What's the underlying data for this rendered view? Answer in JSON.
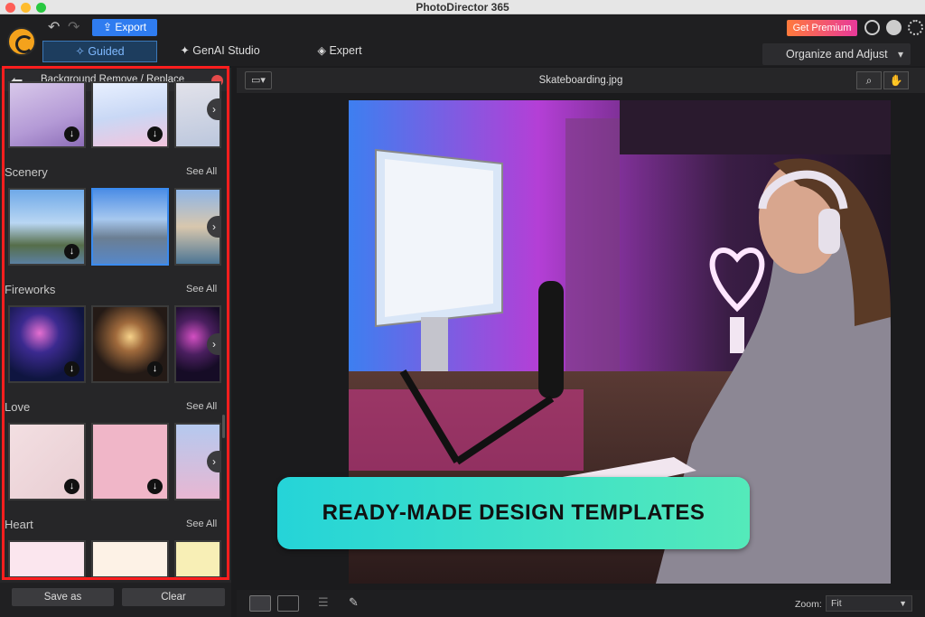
{
  "app": {
    "title": "PhotoDirector 365"
  },
  "toolbar": {
    "export_label": "Export",
    "modes": [
      "Guided",
      "GenAI Studio",
      "Expert"
    ],
    "premium_label": "Get Premium",
    "organize_label": "Organize and Adjust"
  },
  "panel": {
    "title": "Background Remove / Replace",
    "see_all": "See All",
    "sections": [
      "Scenery",
      "Fireworks",
      "Love",
      "Heart"
    ],
    "save_as": "Save as",
    "clear": "Clear"
  },
  "viewer": {
    "filename": "Skateboarding.jpg",
    "zoom_label": "Zoom:",
    "zoom_value": "Fit"
  },
  "banner": {
    "text": "READY-MADE DESIGN TEMPLATES"
  },
  "colors": {
    "accent": "#2f7cf0",
    "highlight_border": "#ff1e1e",
    "banner_start": "#25d4d8",
    "banner_end": "#54eaba"
  }
}
